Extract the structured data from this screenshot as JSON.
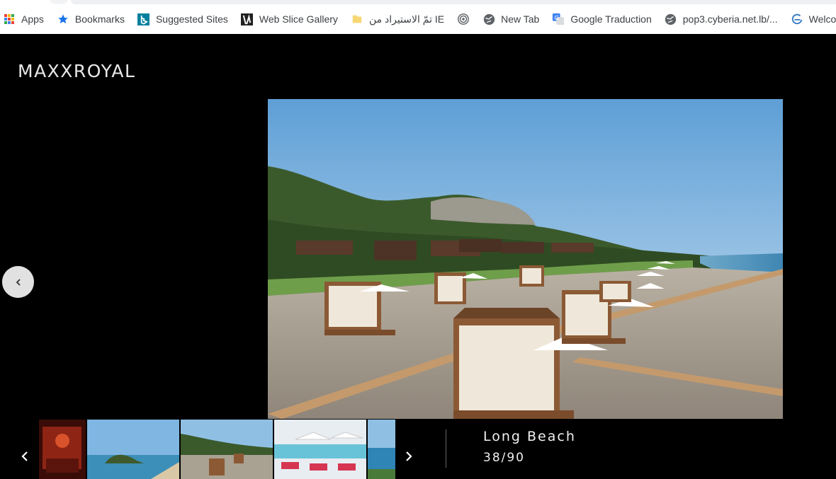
{
  "bookmarks": [
    {
      "label": "Apps",
      "icon": "apps-grid-icon"
    },
    {
      "label": "Bookmarks",
      "icon": "star-icon"
    },
    {
      "label": "Suggested Sites",
      "icon": "bing-icon"
    },
    {
      "label": "Web Slice Gallery",
      "icon": "web-slice-icon"
    },
    {
      "label": "تمّ الاستيراد من IE",
      "icon": "folder-icon"
    },
    {
      "label": "",
      "icon": "fingerprint-icon"
    },
    {
      "label": "New Tab",
      "icon": "globe-icon"
    },
    {
      "label": "Google Traduction",
      "icon": "translate-icon"
    },
    {
      "label": "pop3.cyberia.net.lb/...",
      "icon": "globe-icon"
    },
    {
      "label": "Welcome to RA",
      "icon": "edge-icon"
    }
  ],
  "brand": {
    "logo_text": "MAXX ROYAL"
  },
  "gallery": {
    "caption_title": "Long Beach",
    "counter": "38/90",
    "current_index": 38,
    "total": 90
  },
  "colors": {
    "accent_bing": "#00809d",
    "star_blue": "#1a73e8",
    "folder_yellow": "#f7d774"
  }
}
